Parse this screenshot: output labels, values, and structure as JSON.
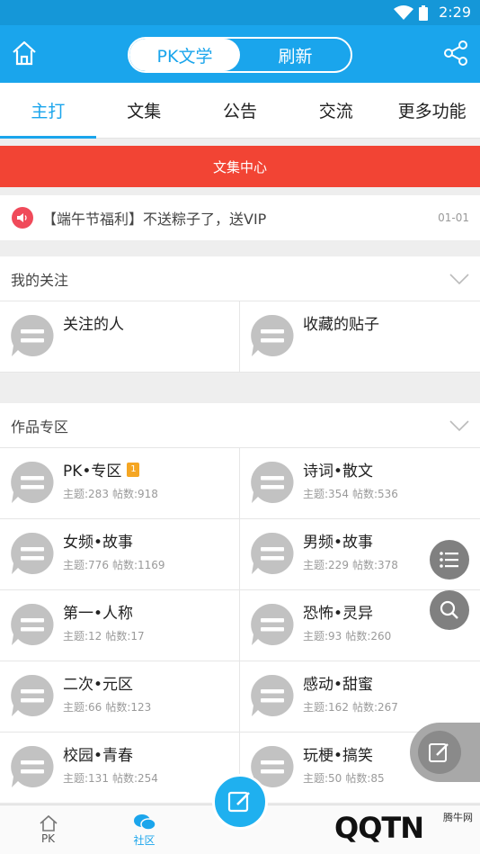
{
  "status": {
    "time": "2:29"
  },
  "header": {
    "segment": [
      "PK文学",
      "刷新"
    ]
  },
  "tabs": [
    "主打",
    "文集",
    "公告",
    "交流",
    "更多功能"
  ],
  "banner": {
    "label": "文集中心"
  },
  "notice": {
    "text": "【端午节福利】不送粽子了，送VIP",
    "date": "01-01"
  },
  "follow": {
    "title": "我的关注",
    "items": [
      {
        "name": "关注的人"
      },
      {
        "name": "收藏的贴子"
      }
    ]
  },
  "works": {
    "title": "作品专区",
    "items": [
      {
        "name": "PK•专区",
        "badge": "1",
        "topics": "主题:283",
        "posts": "帖数:918"
      },
      {
        "name": "诗词•散文",
        "topics": "主题:354",
        "posts": "帖数:536"
      },
      {
        "name": "女频•故事",
        "topics": "主题:776",
        "posts": "帖数:1169"
      },
      {
        "name": "男频•故事",
        "topics": "主题:229",
        "posts": "帖数:378"
      },
      {
        "name": "第一•人称",
        "topics": "主题:12",
        "posts": "帖数:17"
      },
      {
        "name": "恐怖•灵异",
        "topics": "主题:93",
        "posts": "帖数:260"
      },
      {
        "name": "二次•元区",
        "topics": "主题:66",
        "posts": "帖数:123"
      },
      {
        "name": "感动•甜蜜",
        "topics": "主题:162",
        "posts": "帖数:267"
      },
      {
        "name": "校园•青春",
        "topics": "主题:131",
        "posts": "帖数:254"
      },
      {
        "name": "玩梗•搞笑",
        "topics": "主题:50",
        "posts": "帖数:85"
      }
    ]
  },
  "bottom_nav": [
    "PK",
    "社区"
  ],
  "watermark": {
    "brand": "QQTN",
    "tag": "腾牛网"
  },
  "colors": {
    "primary": "#1aa5ec",
    "banner": "#f24434",
    "fab": "#808080"
  }
}
